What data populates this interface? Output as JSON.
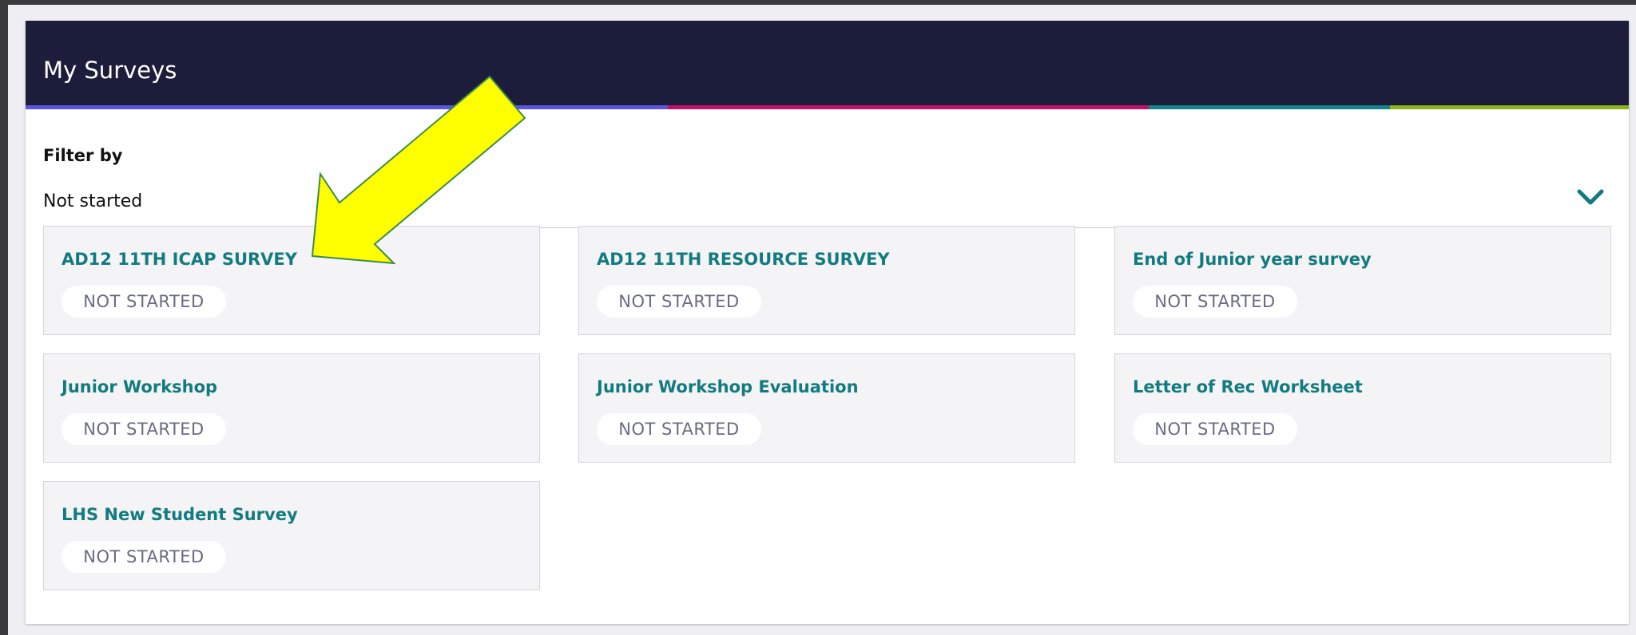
{
  "page_title": "My Surveys",
  "accent_colors": {
    "header_bg": "#1c1d3b",
    "stripe_1": "#5b55e0",
    "stripe_2": "#c0116c",
    "stripe_3": "#11858a",
    "stripe_4": "#8db517",
    "title_color": "#127b7f",
    "arrow_fill": "#ffff00"
  },
  "filter": {
    "label": "Filter by",
    "selected": "Not started",
    "dropdown_icon": "chevron-down-icon"
  },
  "surveys": [
    {
      "title": "AD12 11TH ICAP SURVEY",
      "status": "NOT STARTED"
    },
    {
      "title": "AD12 11TH RESOURCE SURVEY",
      "status": "NOT STARTED"
    },
    {
      "title": "End of Junior year survey",
      "status": "NOT STARTED"
    },
    {
      "title": "Junior Workshop",
      "status": "NOT STARTED"
    },
    {
      "title": "Junior Workshop Evaluation",
      "status": "NOT STARTED"
    },
    {
      "title": "Letter of Rec Worksheet",
      "status": "NOT STARTED"
    },
    {
      "title": "LHS New Student Survey",
      "status": "NOT STARTED"
    }
  ],
  "annotation": {
    "icon": "arrow-annotation-icon"
  }
}
